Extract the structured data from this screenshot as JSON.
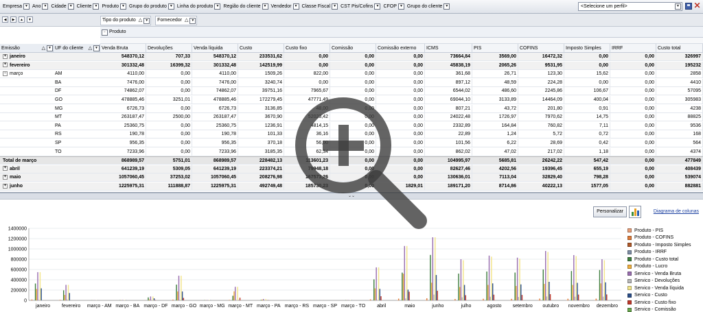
{
  "filters": [
    {
      "label": "Empresa"
    },
    {
      "label": "Ano"
    },
    {
      "label": "Cidade"
    },
    {
      "label": "Cliente"
    },
    {
      "label": "Produto"
    },
    {
      "label": "Grupo do produto"
    },
    {
      "label": "Linha do produto"
    },
    {
      "label": "Região do cliente"
    },
    {
      "label": "Vendedor"
    },
    {
      "label": "Classe Fiscal"
    },
    {
      "label": "CST Pis/Cofins"
    },
    {
      "label": "CFOP"
    },
    {
      "label": "Grupo do cliente"
    }
  ],
  "profile": {
    "value": "<Selecione um perfil>"
  },
  "column_fields": {
    "tipo": "Tipo do produto",
    "fornecedor": "Fornecedor",
    "produto": "Produto"
  },
  "row_fields": {
    "emissao": "Emissão",
    "uf": "UF do cliente"
  },
  "columns": [
    "Venda Bruta",
    "Devoluções",
    "Venda líquida",
    "Custo",
    "Custo fixo",
    "Comissão",
    "Comissão externo",
    "ICMS",
    "PIS",
    "COFINS",
    "Imposto Simples",
    "IRRF",
    "Custo total"
  ],
  "rows": [
    {
      "label": "janeiro",
      "uf": "",
      "kind": "month",
      "values": [
        "548370,12",
        "707,33",
        "548370,12",
        "233531,62",
        "0,00",
        "0,00",
        "0,00",
        "73664,84",
        "3569,00",
        "16472,32",
        "0,00",
        "0,00",
        "326997"
      ]
    },
    {
      "label": "fevereiro",
      "uf": "",
      "kind": "month",
      "values": [
        "301332,48",
        "16399,32",
        "301332,48",
        "142519,99",
        "0,00",
        "0,00",
        "0,00",
        "45838,19",
        "2065,26",
        "9531,95",
        "0,00",
        "0,00",
        "195232"
      ]
    },
    {
      "label": "março",
      "uf": "AM",
      "kind": "sub",
      "values": [
        "4110,00",
        "0,00",
        "4110,00",
        "1509,26",
        "822,00",
        "0,00",
        "0,00",
        "361,68",
        "26,71",
        "123,30",
        "15,62",
        "0,00",
        "2858"
      ]
    },
    {
      "label": "",
      "uf": "BA",
      "kind": "sub",
      "values": [
        "7476,00",
        "0,00",
        "7476,00",
        "3240,74",
        "0,00",
        "0,00",
        "0,00",
        "897,12",
        "48,59",
        "224,28",
        "0,00",
        "0,00",
        "4410"
      ]
    },
    {
      "label": "",
      "uf": "DF",
      "kind": "sub",
      "values": [
        "74862,07",
        "0,00",
        "74862,07",
        "39751,16",
        "7965,67",
        "0,00",
        "0,00",
        "6544,02",
        "486,60",
        "2245,86",
        "106,67",
        "0,00",
        "57095"
      ]
    },
    {
      "label": "",
      "uf": "GO",
      "kind": "sub",
      "values": [
        "478885,46",
        "3251,01",
        "478885,46",
        "172279,45",
        "47771,49",
        "0,00",
        "0,00",
        "69044,10",
        "3133,89",
        "14464,09",
        "400,04",
        "0,00",
        "305983"
      ]
    },
    {
      "label": "",
      "uf": "MG",
      "kind": "sub",
      "values": [
        "6726,73",
        "0,00",
        "6726,73",
        "3136,85",
        "48,00",
        "0,00",
        "0,00",
        "807,21",
        "43,72",
        "201,80",
        "0,91",
        "0,00",
        "4238"
      ]
    },
    {
      "label": "",
      "uf": "MT",
      "kind": "sub",
      "values": [
        "263187,47",
        "2500,00",
        "263187,47",
        "3670,90",
        "52023,42",
        "0,00",
        "0,00",
        "24022,48",
        "1726,97",
        "7970,62",
        "14,75",
        "0,00",
        "88825"
      ]
    },
    {
      "label": "",
      "uf": "PA",
      "kind": "sub",
      "values": [
        "25360,75",
        "0,00",
        "25360,75",
        "1236,91",
        "4814,15",
        "0,00",
        "0,00",
        "2332,89",
        "164,84",
        "760,82",
        "7,11",
        "0,00",
        "9536"
      ]
    },
    {
      "label": "",
      "uf": "RS",
      "kind": "sub",
      "values": [
        "190,78",
        "0,00",
        "190,78",
        "101,33",
        "36,16",
        "0,00",
        "0,00",
        "22,89",
        "1,24",
        "5,72",
        "0,72",
        "0,00",
        "168"
      ]
    },
    {
      "label": "",
      "uf": "SP",
      "kind": "sub",
      "values": [
        "956,35",
        "0,00",
        "956,35",
        "370,18",
        "56,00",
        "0,00",
        "0,00",
        "101,56",
        "6,22",
        "28,69",
        "0,42",
        "0,00",
        "564"
      ]
    },
    {
      "label": "",
      "uf": "TO",
      "kind": "sub",
      "values": [
        "7233,96",
        "0,00",
        "7233,96",
        "3185,35",
        "62,34",
        "0,00",
        "0,00",
        "862,02",
        "47,02",
        "217,02",
        "1,18",
        "0,00",
        "4374"
      ]
    },
    {
      "label": "Total de março",
      "uf": "",
      "kind": "total",
      "values": [
        "868989,57",
        "5751,01",
        "868989,57",
        "228482,13",
        "113601,23",
        "0,00",
        "0,00",
        "104995,97",
        "5685,81",
        "26242,22",
        "547,42",
        "0,00",
        "477849"
      ]
    },
    {
      "label": "abril",
      "uf": "",
      "kind": "month",
      "values": [
        "641239,19",
        "5309,05",
        "641239,19",
        "223374,21",
        "79948,18",
        "0,00",
        "0,00",
        "82627,46",
        "4202,56",
        "19396,45",
        "655,19",
        "0,00",
        "408439"
      ]
    },
    {
      "label": "maio",
      "uf": "",
      "kind": "month",
      "values": [
        "1057060,45",
        "37253,02",
        "1057060,45",
        "208276,98",
        "167573,26",
        "0,00",
        "0,00",
        "130636,01",
        "7113,04",
        "32829,40",
        "798,28",
        "0,00",
        "539074"
      ]
    },
    {
      "label": "junho",
      "uf": "",
      "kind": "month",
      "values": [
        "1225975,31",
        "111888,87",
        "1225975,31",
        "492749,48",
        "185730,23",
        "0,00",
        "1829,01",
        "189171,20",
        "8714,86",
        "40222,13",
        "1577,05",
        "0,00",
        "882881"
      ]
    }
  ],
  "splitter": {
    "glyph": "⌄⌄"
  },
  "chart_panel": {
    "personalizar": "Personalizar",
    "diagram_link": "Diagrama de colunas"
  },
  "chart_data": {
    "type": "bar",
    "categories": [
      "janeiro",
      "fevereiro",
      "março - AM",
      "março - BA",
      "março - DF",
      "março - GO",
      "março - MG",
      "março - MT",
      "março - PA",
      "março - RS",
      "março - SP",
      "março - TO",
      "abril",
      "maio",
      "junho",
      "julho",
      "agosto",
      "setembro",
      "outubro",
      "novembro",
      "dezembro"
    ],
    "ylim": [
      0,
      1400000
    ],
    "yticks": [
      "0",
      "200000",
      "400000",
      "600000",
      "800000",
      "1000000",
      "1200000",
      "1400000"
    ],
    "grid": true,
    "legend": "right",
    "series": [
      {
        "name": "Produto - PIS",
        "color": "#e8a07a",
        "values": [
          3569,
          2065,
          27,
          49,
          487,
          3134,
          44,
          1727,
          165,
          1,
          6,
          47,
          4203,
          7113,
          8715,
          5200,
          6100,
          5800,
          6900,
          6300,
          6700
        ]
      },
      {
        "name": "Produto - COFINS",
        "color": "#e07b39",
        "values": [
          16472,
          9532,
          123,
          224,
          2246,
          14464,
          202,
          7971,
          761,
          6,
          29,
          217,
          19396,
          32829,
          40222,
          26000,
          30500,
          28800,
          34000,
          31000,
          33000
        ]
      },
      {
        "name": "Produto - Imposto Simples",
        "color": "#b05a2a",
        "values": [
          0,
          0,
          16,
          0,
          107,
          400,
          1,
          15,
          7,
          1,
          0,
          1,
          655,
          798,
          1577,
          900,
          1000,
          950,
          1100,
          1050,
          1080
        ]
      },
      {
        "name": "Produto - IRRF",
        "color": "#7f8fa6",
        "values": [
          0,
          0,
          0,
          0,
          0,
          0,
          0,
          0,
          0,
          0,
          0,
          0,
          0,
          0,
          0,
          0,
          0,
          0,
          0,
          0,
          0
        ]
      },
      {
        "name": "Produto - Custo total",
        "color": "#3f7f3f",
        "values": [
          326997,
          195232,
          2858,
          4410,
          57095,
          305983,
          4238,
          88825,
          9536,
          168,
          564,
          4374,
          408439,
          539074,
          882881,
          520000,
          560000,
          540000,
          600000,
          570000,
          590000
        ]
      },
      {
        "name": "Produto - Lucro",
        "color": "#f0b040",
        "values": [
          221373,
          106100,
          1252,
          3066,
          17767,
          172902,
          2489,
          174362,
          15825,
          23,
          392,
          2860,
          232800,
          517986,
          343094,
          260000,
          300000,
          280000,
          320000,
          300000,
          330000
        ]
      },
      {
        "name": "Servico - Venda Bruta",
        "color": "#9a6fb0",
        "values": [
          548370,
          301332,
          4110,
          7476,
          74862,
          478885,
          6727,
          263187,
          25361,
          191,
          956,
          7234,
          641239,
          1057060,
          1225975,
          800000,
          870000,
          830000,
          960000,
          880000,
          800000
        ]
      },
      {
        "name": "Servico - Devoluções",
        "color": "#b8b8b8",
        "values": [
          707,
          16399,
          0,
          0,
          0,
          3251,
          0,
          2500,
          0,
          0,
          0,
          0,
          5309,
          37253,
          111889,
          60000,
          70000,
          65000,
          75000,
          70000,
          72000
        ]
      },
      {
        "name": "Servico - Venda líquida",
        "color": "#f3e58a",
        "values": [
          548370,
          301332,
          4110,
          7476,
          74862,
          478885,
          6727,
          263187,
          25361,
          191,
          956,
          7234,
          641239,
          1057060,
          1225975,
          780000,
          850000,
          810000,
          940000,
          860000,
          780000
        ]
      },
      {
        "name": "Servico - Custo",
        "color": "#2b4f8a",
        "values": [
          233532,
          142520,
          1509,
          3241,
          39751,
          172279,
          3137,
          3671,
          1237,
          101,
          370,
          3185,
          223374,
          208277,
          492749,
          300000,
          330000,
          310000,
          360000,
          340000,
          350000
        ]
      },
      {
        "name": "Servico - Custo fixo",
        "color": "#c0392b",
        "values": [
          0,
          0,
          822,
          0,
          7966,
          47771,
          48,
          52023,
          4814,
          36,
          56,
          62,
          79948,
          167573,
          185730,
          100000,
          110000,
          105000,
          120000,
          112000,
          115000
        ]
      },
      {
        "name": "Servico - Comissão",
        "color": "#6aa84f",
        "values": [
          0,
          0,
          0,
          0,
          0,
          0,
          0,
          0,
          0,
          0,
          0,
          0,
          0,
          0,
          0,
          0,
          0,
          0,
          0,
          0,
          0
        ]
      }
    ]
  },
  "watermark": {
    "icon": "zoom-in-magnifier-icon"
  }
}
